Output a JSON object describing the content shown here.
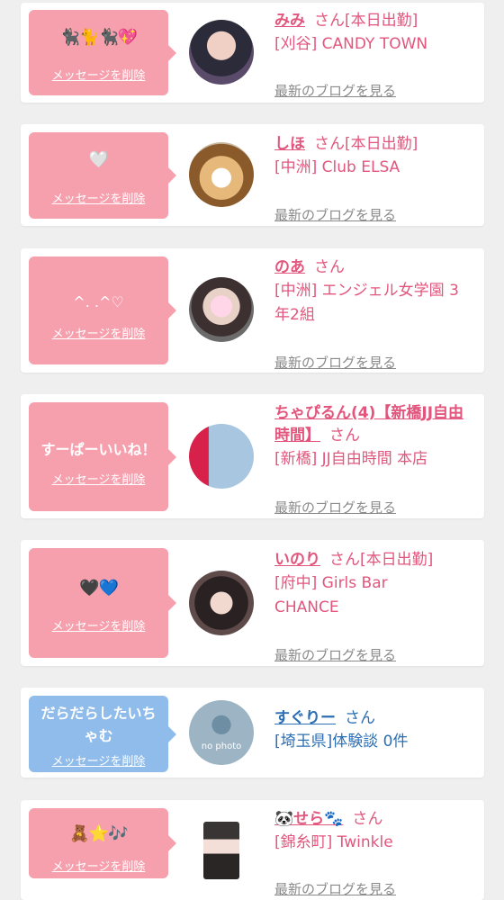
{
  "colors": {
    "pink_bubble": "#f6a0ae",
    "blue_bubble": "#8fbcea",
    "name_pink": "#e2567d",
    "name_blue": "#2c6fb3",
    "link_gray": "#8a8a8a"
  },
  "entries": [
    {
      "message": "🐈‍⬛🐈🐈‍⬛💖",
      "delete_label": "メッセージを削除",
      "name": "みみ",
      "suffix": "さん[本日出勤]",
      "shop": "[刈谷] CANDY TOWN",
      "blog_link": "最新のブログを見る"
    },
    {
      "message": "🤍",
      "delete_label": "メッセージを削除",
      "name": "しほ",
      "suffix": "さん[本日出勤]",
      "shop": "[中洲] Club ELSA",
      "blog_link": "最新のブログを見る"
    },
    {
      "message": "^. .^♡",
      "delete_label": "メッセージを削除",
      "name": "のあ",
      "suffix": "さん",
      "shop": "[中洲] エンジェル女学園 3年2組",
      "blog_link": "最新のブログを見る"
    },
    {
      "message": "すーぱーいいね！",
      "delete_label": "メッセージを削除",
      "name": "ちゃぴるん(4)【新橋JJ自由時間】",
      "suffix": "さん",
      "shop": "[新橋] JJ自由時間 本店",
      "blog_link": "最新のブログを見る"
    },
    {
      "message": "🖤💙",
      "delete_label": "メッセージを削除",
      "name": "いのり",
      "suffix": "さん[本日出勤]",
      "shop": "[府中] Girls Bar CHANCE",
      "blog_link": "最新のブログを見る"
    },
    {
      "message": "だらだらしたいちゃむ",
      "delete_label": "メッセージを削除",
      "name": "すぐりー",
      "suffix": "さん",
      "shop": "[埼玉県]体験談 0件",
      "avatar_text": "no photo"
    },
    {
      "message": "🧸⭐🎶",
      "delete_label": "メッセージを削除",
      "name": "🐼せら🐾",
      "suffix": "さん",
      "shop": "[錦糸町] Twinkle",
      "blog_link": "最新のブログを見る"
    }
  ]
}
